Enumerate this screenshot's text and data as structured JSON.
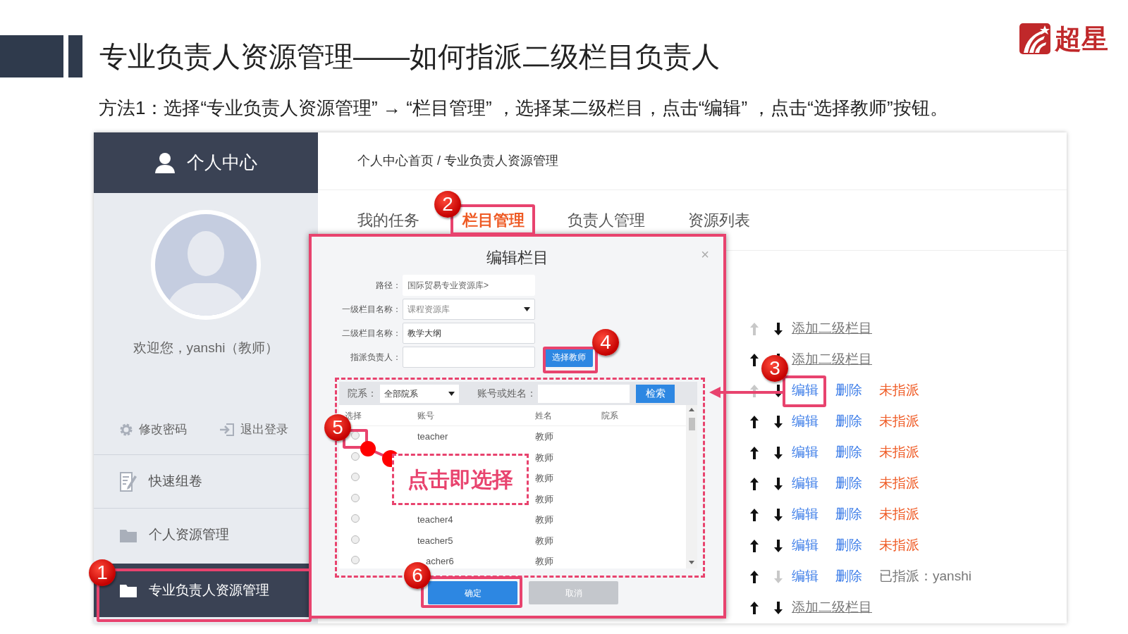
{
  "slide": {
    "title": "专业负责人资源管理——如何指派二级栏目负责人",
    "subtitle": "方法1：选择“专业负责人资源管理” → “栏目管理” ，选择某二级栏目，点击“编辑” ，点击“选择教师”按钮。",
    "logo_text": "超星"
  },
  "sidebar": {
    "title": "个人中心",
    "welcome": "欢迎您，yanshi（教师）",
    "links": [
      {
        "label": "修改密码",
        "kind": "settings"
      },
      {
        "label": "退出登录",
        "kind": "logout"
      }
    ],
    "items": [
      {
        "label": "快速组卷",
        "kind": "compose",
        "selected": false
      },
      {
        "label": "个人资源管理",
        "kind": "folder",
        "selected": false
      },
      {
        "label": "专业负责人资源管理",
        "kind": "folder",
        "selected": true
      }
    ]
  },
  "breadcrumb": "个人中心首页 / 专业负责人资源管理",
  "tabs": [
    {
      "label": "我的任务",
      "selected": false
    },
    {
      "label": "栏目管理",
      "selected": true
    },
    {
      "label": "负责人管理",
      "selected": false
    },
    {
      "label": "资源列表",
      "selected": false
    }
  ],
  "column_rows": [
    {
      "kind": "add",
      "up_enabled": false,
      "down_enabled": true,
      "label": "添加二级栏目"
    },
    {
      "kind": "add",
      "up_enabled": true,
      "down_enabled": true,
      "label": "添加二级栏目"
    },
    {
      "kind": "item",
      "up_enabled": false,
      "down_enabled": true,
      "edit": "编辑",
      "delete": "删除",
      "status": "未指派",
      "assigned": false
    },
    {
      "kind": "item",
      "up_enabled": true,
      "down_enabled": true,
      "edit": "编辑",
      "delete": "删除",
      "status": "未指派",
      "assigned": false
    },
    {
      "kind": "item",
      "up_enabled": true,
      "down_enabled": true,
      "edit": "编辑",
      "delete": "删除",
      "status": "未指派",
      "assigned": false
    },
    {
      "kind": "item",
      "up_enabled": true,
      "down_enabled": true,
      "edit": "编辑",
      "delete": "删除",
      "status": "未指派",
      "assigned": false
    },
    {
      "kind": "item",
      "up_enabled": true,
      "down_enabled": true,
      "edit": "编辑",
      "delete": "删除",
      "status": "未指派",
      "assigned": false
    },
    {
      "kind": "item",
      "up_enabled": true,
      "down_enabled": true,
      "edit": "编辑",
      "delete": "删除",
      "status": "未指派",
      "assigned": false
    },
    {
      "kind": "item",
      "up_enabled": true,
      "down_enabled": false,
      "edit": "编辑",
      "delete": "删除",
      "status": "已指派：yanshi",
      "assigned": true
    },
    {
      "kind": "add",
      "up_enabled": true,
      "down_enabled": true,
      "label": "添加二级栏目"
    }
  ],
  "modal": {
    "title": "编辑栏目",
    "close": "×",
    "fields": [
      {
        "kind": "static",
        "label": "路径：",
        "value": "国际贸易专业资源库>"
      },
      {
        "kind": "select",
        "label": "一级栏目名称：",
        "value": "课程资源库"
      },
      {
        "kind": "input",
        "label": "二级栏目名称：",
        "value": "教学大纲"
      },
      {
        "kind": "input",
        "label": "指派负责人："
      }
    ],
    "select_teacher_button": "选择教师",
    "filter": {
      "department_label": "院系：",
      "department_value": "全部院系",
      "search_label": "账号或姓名：",
      "search_button": "检索"
    },
    "table": {
      "columns": [
        "选择",
        "账号",
        "姓名",
        "院系"
      ],
      "rows": [
        {
          "selected": false,
          "account": "teacher",
          "name": "教师"
        },
        {
          "selected": false,
          "name": "教师"
        },
        {
          "selected": false,
          "name": "教师"
        },
        {
          "selected": false,
          "name": "教师"
        },
        {
          "selected": false,
          "account": "teacher4",
          "name": "教师"
        },
        {
          "selected": false,
          "account": "teacher5",
          "name": "教师"
        },
        {
          "selected": false,
          "account": "acher6",
          "name": "教师"
        }
      ]
    },
    "buttons": [
      {
        "label": "确定",
        "kind": "primary"
      },
      {
        "label": "取消",
        "kind": "secondary"
      }
    ]
  },
  "annotations": [
    {
      "number": "1"
    },
    {
      "number": "2"
    },
    {
      "number": "3"
    },
    {
      "number": "4"
    },
    {
      "number": "5"
    },
    {
      "number": "6"
    }
  ],
  "callout": "点击即选择"
}
